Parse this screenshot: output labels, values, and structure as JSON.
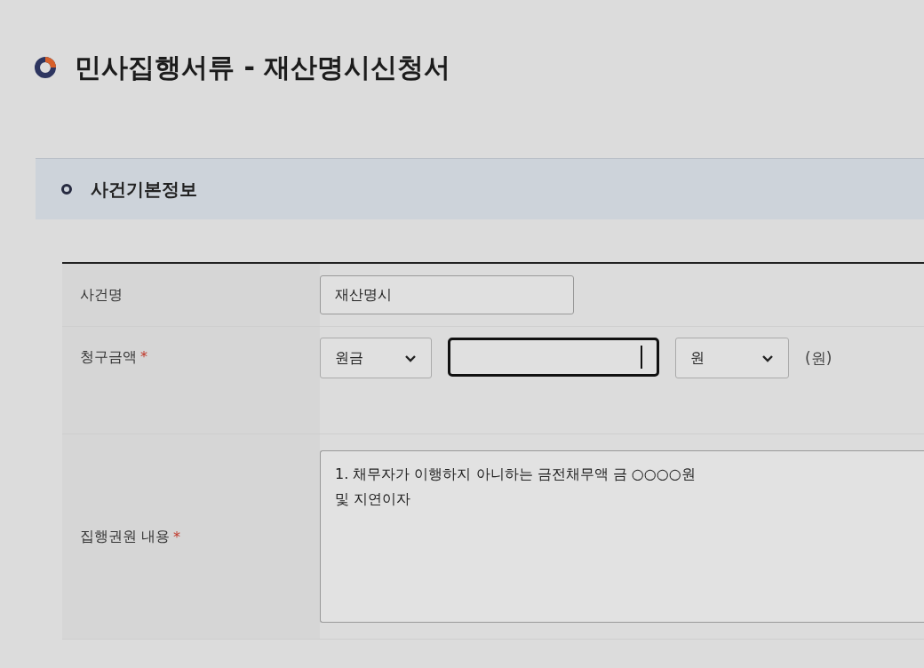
{
  "page_title": "민사집행서류 - 재산명시신청서",
  "section": {
    "title": "사건기본정보"
  },
  "form": {
    "rows": [
      {
        "kind": "text",
        "label": "사건명",
        "value": "재산명시"
      },
      {
        "kind": "amount",
        "label": "청구금액",
        "required_mark": "*",
        "type_select": "원금",
        "amount": "",
        "unit_select": "원",
        "unit_note": "(원)"
      },
      {
        "kind": "textarea",
        "label": "집행권원 내용",
        "required_mark": "*",
        "value": "1. 채무자가 이행하지 아니하는 금전채무액  금 ○○○○원\n및 지연이자"
      }
    ]
  }
}
